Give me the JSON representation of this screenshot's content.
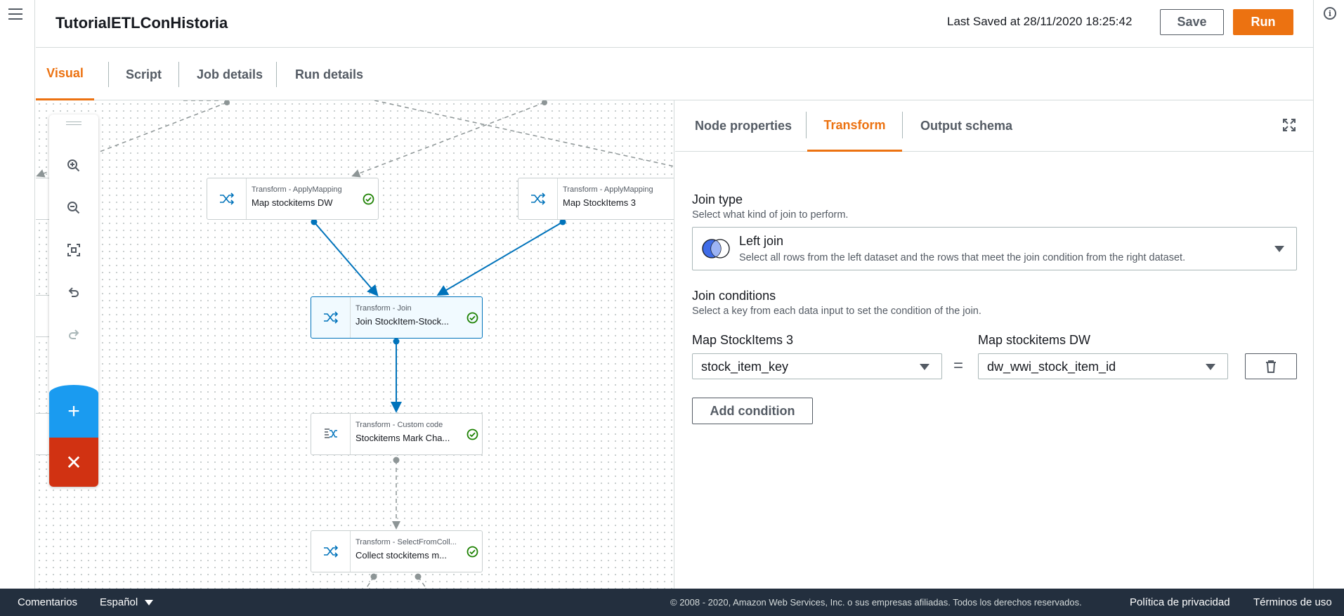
{
  "header": {
    "job_title": "TutorialETLConHistoria",
    "last_saved": "Last Saved at 28/11/2020 18:25:42",
    "save_label": "Save",
    "run_label": "Run"
  },
  "main_tabs": [
    {
      "label": "Visual",
      "active": true
    },
    {
      "label": "Script",
      "active": false
    },
    {
      "label": "Job details",
      "active": false
    },
    {
      "label": "Run details",
      "active": false
    }
  ],
  "canvas": {
    "nodes": [
      {
        "type": "Transform - ApplyMapping",
        "name": "Map stockitems DW",
        "status": "success"
      },
      {
        "type": "Transform - ApplyMapping",
        "name": "Map StockItems 3",
        "status": "success"
      },
      {
        "type": "Transform - Join",
        "name": "Join StockItem-Stock...",
        "status": "success",
        "selected": true
      },
      {
        "type": "Transform - Custom code",
        "name": "Stockitems Mark Cha...",
        "status": "success"
      },
      {
        "type": "Transform - SelectFromColl...",
        "name": "Collect stockitems m...",
        "status": "success"
      }
    ],
    "toolbar": [
      "zoom-in-icon",
      "zoom-out-icon",
      "fit-to-screen-icon",
      "undo-icon",
      "redo-icon"
    ],
    "add_label": "+",
    "remove_label": "✕"
  },
  "panel": {
    "tabs": [
      {
        "label": "Node properties",
        "active": false
      },
      {
        "label": "Transform",
        "active": true
      },
      {
        "label": "Output schema",
        "active": false
      }
    ],
    "join_type": {
      "label": "Join type",
      "description": "Select what kind of join to perform.",
      "selected_label": "Left join",
      "selected_description": "Select all rows from the left dataset and the rows that meet the join condition from the right dataset."
    },
    "join_conditions": {
      "label": "Join conditions",
      "description": "Select a key from each data input to set the condition of the join.",
      "left_input_label": "Map StockItems 3",
      "right_input_label": "Map stockitems DW",
      "left_key": "stock_item_key",
      "right_key": "dw_wwi_stock_item_id",
      "operator": "=",
      "add_condition_label": "Add condition"
    }
  },
  "footer": {
    "feedback": "Comentarios",
    "language": "Español",
    "copyright": "© 2008 - 2020, Amazon Web Services, Inc. o sus empresas afiliadas. Todos los derechos reservados.",
    "privacy": "Política de privacidad",
    "terms": "Términos de uso"
  },
  "colors": {
    "accent": "#ec7211",
    "edge": "#0073bb",
    "success": "#1d8102",
    "add": "#1a9bf0",
    "remove": "#d13212",
    "footer_bg": "#232f3e"
  }
}
